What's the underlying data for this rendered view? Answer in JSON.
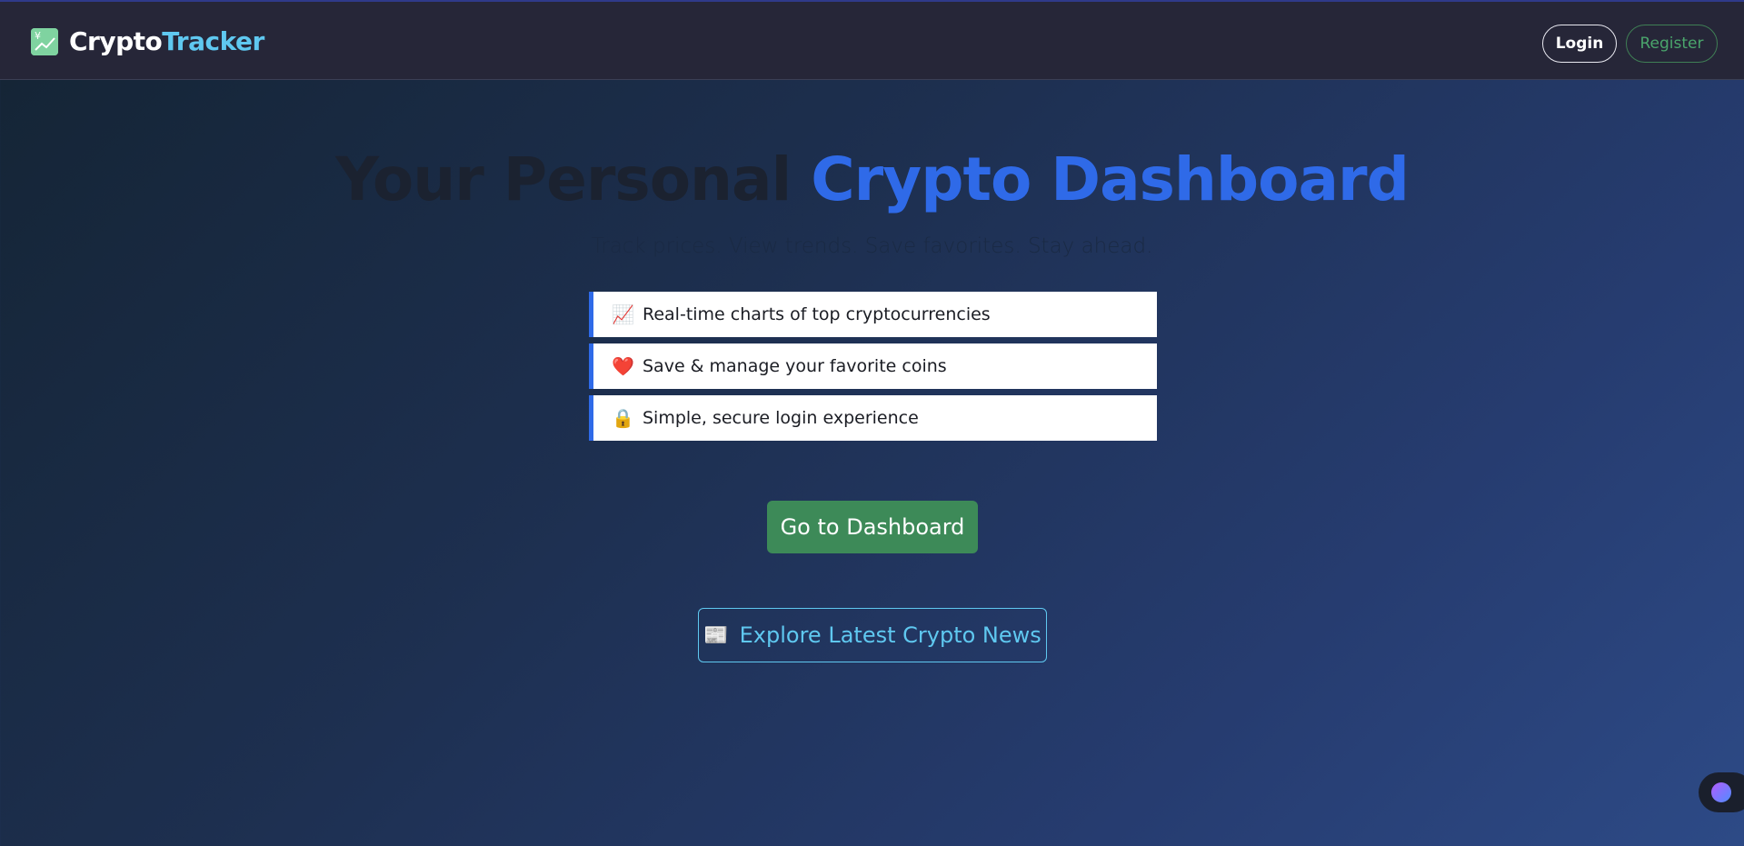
{
  "navbar": {
    "brand_part1": "Crypto",
    "brand_part2": "Tracker",
    "brand_icon": "chart-increasing-icon",
    "login_label": "Login",
    "register_label": "Register"
  },
  "hero": {
    "title_part1": "Your Personal",
    "title_part2": "Crypto Dashboard",
    "subtitle": "Track prices. View trends. Save favorites. Stay ahead."
  },
  "features": [
    {
      "icon": "📈",
      "icon_name": "chart-increasing-icon",
      "label": "Real-time charts of top cryptocurrencies"
    },
    {
      "icon": "❤️",
      "icon_name": "heart-icon",
      "label": "Save & manage your favorite coins"
    },
    {
      "icon": "🔒",
      "icon_name": "lock-icon",
      "label": "Simple, secure login experience"
    }
  ],
  "actions": {
    "dashboard_label": "Go to Dashboard",
    "news_icon": "📰",
    "news_label": "Explore Latest Crypto News"
  },
  "colors": {
    "accent_blue": "#2f6ae8",
    "accent_cyan": "#5fc8f0",
    "accent_green": "#3d8a58"
  }
}
